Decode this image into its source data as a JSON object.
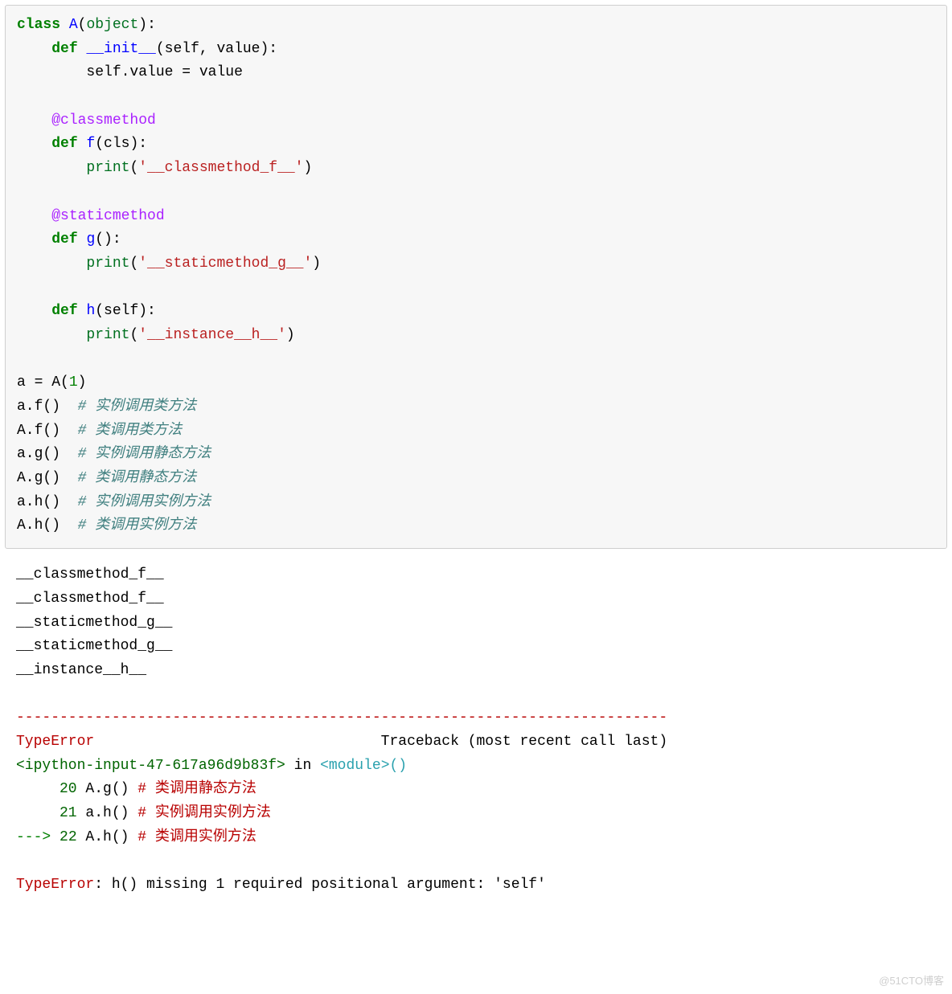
{
  "code": {
    "class_kw": "class",
    "class_name": "A",
    "object_builtin": "object",
    "def_kw": "def",
    "init_name": "__init__",
    "init_params": "(self, value):",
    "init_body_prefix": "self.value ",
    "init_body_eq": "=",
    "init_body_val": " value",
    "classmethod_dec": "@classmethod",
    "f_name": "f",
    "f_params": "(cls):",
    "print_name": "print",
    "f_str": "'__classmethod_f__'",
    "staticmethod_dec": "@staticmethod",
    "g_name": "g",
    "g_params": "():",
    "g_str": "'__staticmethod_g__'",
    "h_name": "h",
    "h_params": "(self):",
    "h_str": "'__instance__h__'",
    "a_assign_left": "a ",
    "assign_eq": "=",
    "a_assign_right": " A(",
    "num_one": "1",
    "close_paren": ")",
    "call_a_f": "a.f()  ",
    "comment_a_f": "# 实例调用类方法",
    "call_A_f": "A.f()  ",
    "comment_A_f": "# 类调用类方法",
    "call_a_g": "a.g()  ",
    "comment_a_g": "# 实例调用静态方法",
    "call_A_g": "A.g()  ",
    "comment_A_g": "# 类调用静态方法",
    "call_a_h": "a.h()  ",
    "comment_a_h": "# 实例调用实例方法",
    "call_A_h": "A.h()  ",
    "comment_A_h": "# 类调用实例方法",
    "colon": ":"
  },
  "output": {
    "line1": "__classmethod_f__",
    "line2": "__classmethod_f__",
    "line3": "__staticmethod_g__",
    "line4": "__staticmethod_g__",
    "line5": "__instance__h__",
    "sep": "---------------------------------------------------------------------------",
    "err_name": "TypeError",
    "traceback_label": "                                 Traceback (most recent call last)",
    "ipy_input": "<ipython-input-47-617a96d9b83f>",
    "in_word": " in ",
    "module_link": "<module>",
    "module_parens": "()",
    "tb_20_num": "     20",
    "tb_20_code_pre": " A",
    "tb_20_code_dot": ".",
    "tb_20_code_g": "g",
    "tb_20_parens": "()",
    "tb_20_comment": " # 类调用静态方法",
    "tb_21_num": "     21",
    "tb_21_code_pre": " a",
    "tb_21_code_dot": ".",
    "tb_21_code_h": "h",
    "tb_21_parens": "()",
    "tb_21_comment": " # 实例调用实例方法",
    "tb_arrow": "---> ",
    "tb_22_num": "22",
    "tb_22_code_pre": " A",
    "tb_22_code_dot": ".",
    "tb_22_code_h": "h",
    "tb_22_parens": "()",
    "tb_22_comment": " # 类调用实例方法",
    "final_err_name": "TypeError",
    "final_err_msg": ": h() missing 1 required positional argument: 'self'"
  },
  "watermark": "@51CTO博客"
}
